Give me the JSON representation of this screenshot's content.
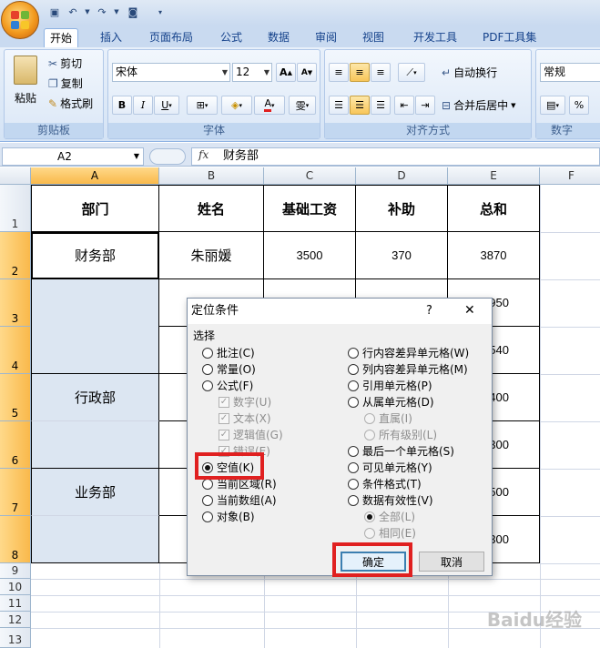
{
  "ribbon": {
    "tabs": [
      "开始",
      "插入",
      "页面布局",
      "公式",
      "数据",
      "审阅",
      "视图",
      "开发工具",
      "PDF工具集"
    ],
    "clipboard": {
      "paste": "粘贴",
      "cut": "剪切",
      "copy": "复制",
      "format_painter": "格式刷",
      "label": "剪贴板"
    },
    "font": {
      "name": "宋体",
      "size": "12",
      "label": "字体"
    },
    "alignment": {
      "wrap": "自动换行",
      "merge": "合并后居中",
      "label": "对齐方式"
    },
    "number": {
      "format": "常规",
      "label": "数字"
    }
  },
  "formula_bar": {
    "name_box": "A2",
    "fx": "fx",
    "content": "财务部"
  },
  "sheet": {
    "columns": [
      "A",
      "B",
      "C",
      "D",
      "E",
      "F"
    ],
    "rows": [
      "1",
      "2",
      "3",
      "4",
      "5",
      "6",
      "7",
      "8",
      "9",
      "10",
      "11",
      "12",
      "13"
    ],
    "headers": {
      "dept": "部门",
      "name": "姓名",
      "base": "基础工资",
      "subsidy": "补助",
      "total": "总和"
    },
    "r2": {
      "dept": "财务部",
      "name": "朱丽媛",
      "base": "3500",
      "subsidy": "370",
      "total": "3870"
    },
    "dept_admin": "行政部",
    "dept_business": "业务部",
    "partial": {
      "r3": "950",
      "r4": "540",
      "r5": "400",
      "r6": "300",
      "r7": "500",
      "r8": "300"
    }
  },
  "dialog": {
    "title": "定位条件",
    "help": "?",
    "close": "✕",
    "section": "选择",
    "left_options": [
      "批注(C)",
      "常量(O)",
      "公式(F)"
    ],
    "formula_subs": [
      "数字(U)",
      "文本(X)",
      "逻辑值(G)",
      "错误(E)"
    ],
    "left_options2": [
      "空值(K)",
      "当前区域(R)",
      "当前数组(A)",
      "对象(B)"
    ],
    "right_options": [
      "行内容差异单元格(W)",
      "列内容差异单元格(M)",
      "引用单元格(P)",
      "从属单元格(D)"
    ],
    "dep_subs": [
      "直属(I)",
      "所有级别(L)"
    ],
    "right_options2": [
      "最后一个单元格(S)",
      "可见单元格(Y)",
      "条件格式(T)",
      "数据有效性(V)"
    ],
    "valid_subs": [
      "全部(L)",
      "相同(E)"
    ],
    "ok": "确定",
    "cancel": "取消"
  },
  "watermark": "Baidu经验",
  "colors": {
    "accent_red": "#e02020",
    "ribbon_blue": "#c9daf0",
    "selection_fill": "#dce6f2"
  }
}
